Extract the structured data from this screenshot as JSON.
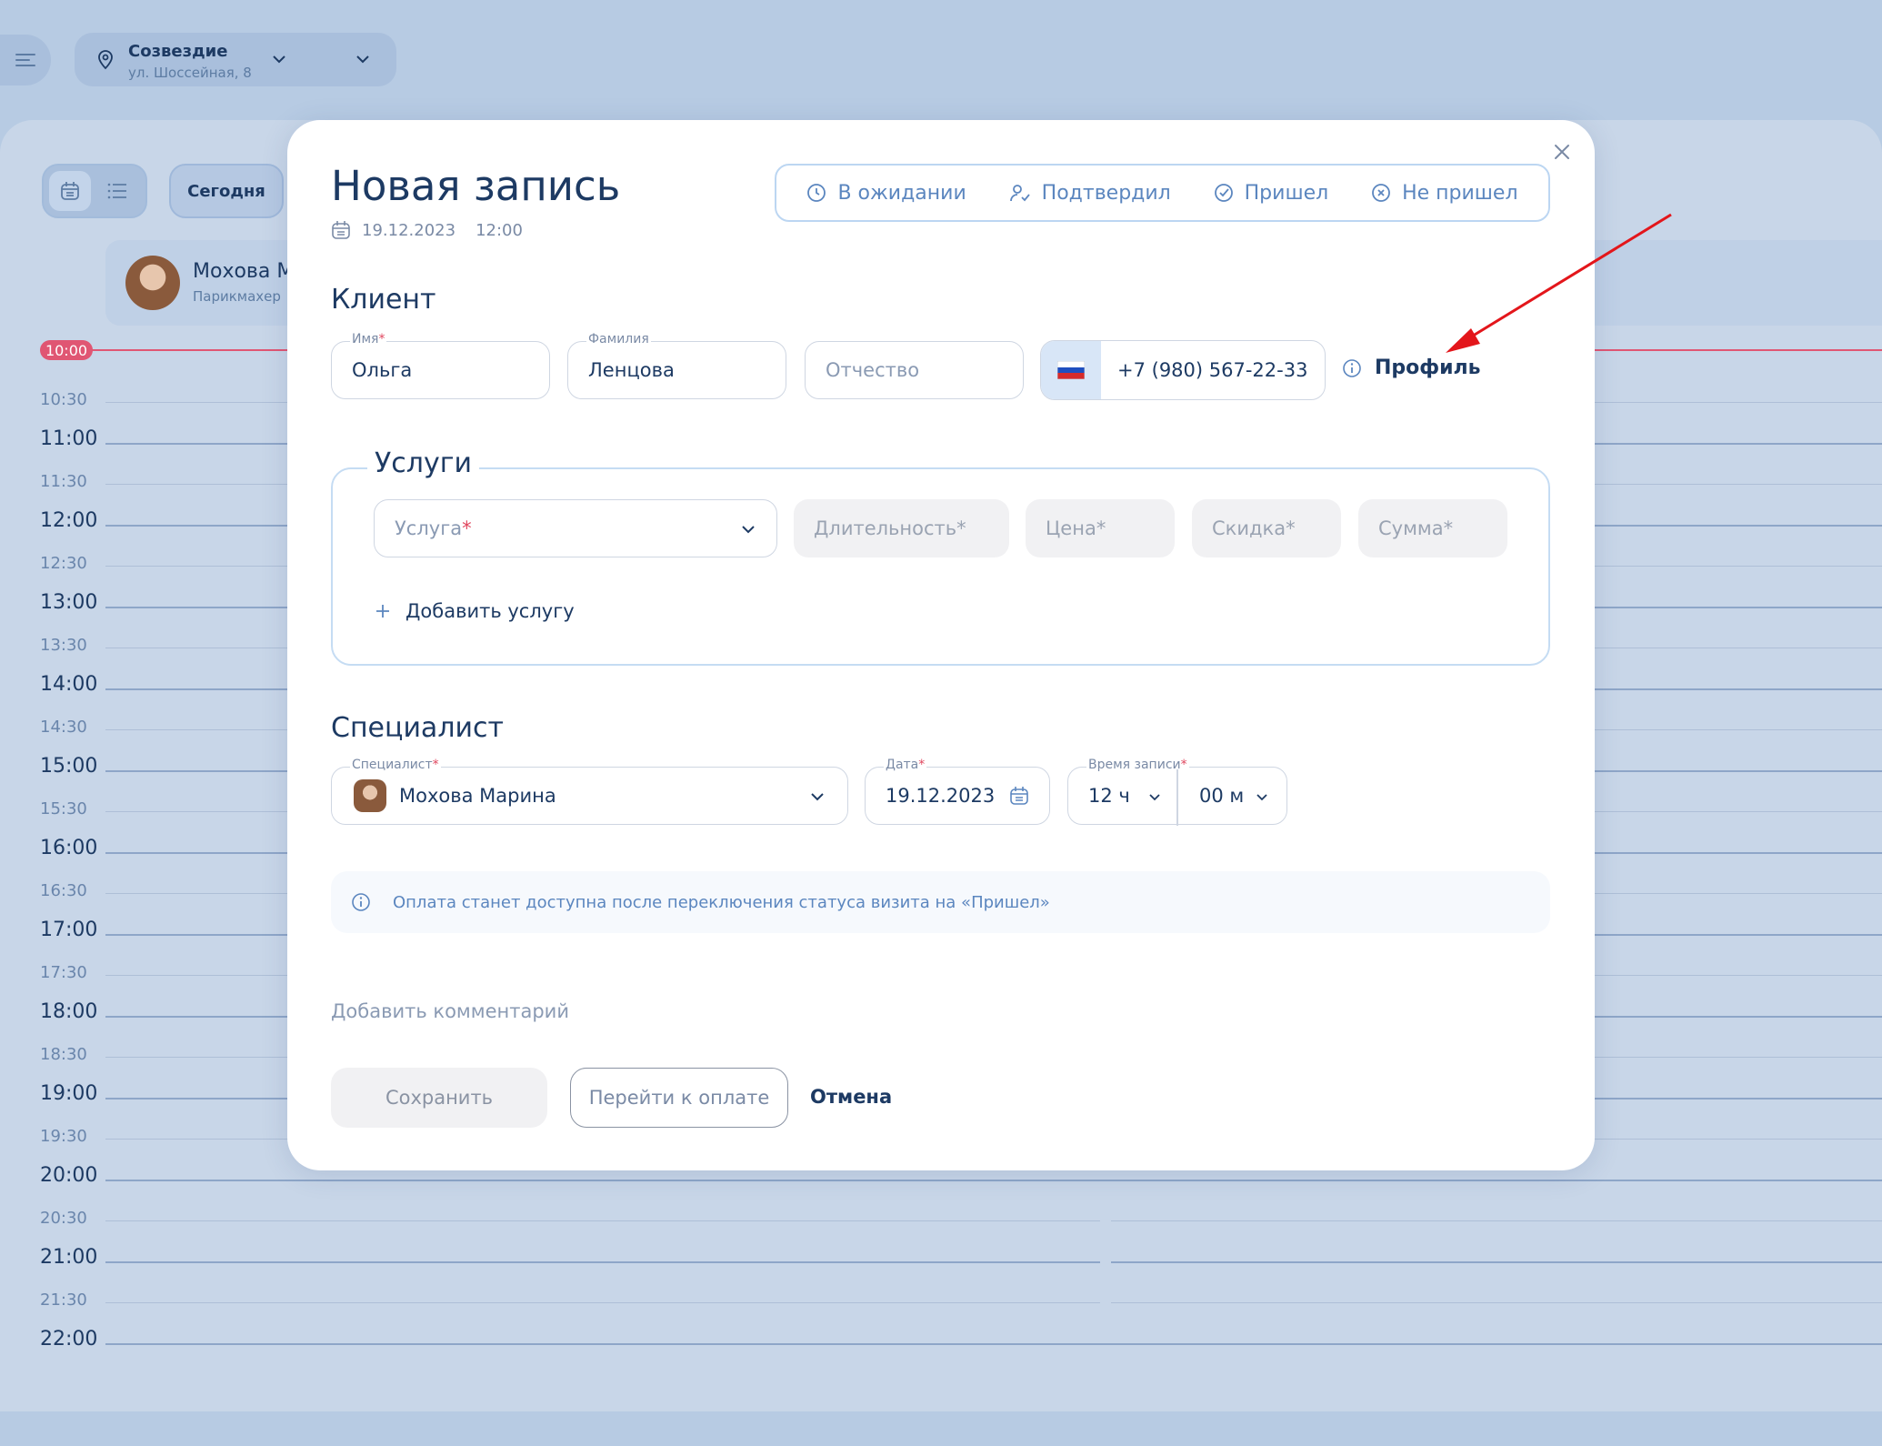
{
  "topbar": {
    "location_name": "Созвездие",
    "location_address": "ул. Шоссейная, 8"
  },
  "toolbar": {
    "today_label": "Сегодня"
  },
  "staff": {
    "name": "Мохова М",
    "role": "Парикмахер"
  },
  "timeline": {
    "now_badge": "10:00",
    "slots": [
      "10:30",
      "11:00",
      "11:30",
      "12:00",
      "12:30",
      "13:00",
      "13:30",
      "14:00",
      "14:30",
      "15:00",
      "15:30",
      "16:00",
      "16:30",
      "17:00",
      "17:30",
      "18:00",
      "18:30",
      "19:00",
      "19:30",
      "20:00",
      "20:30",
      "21:00",
      "21:30",
      "22:00"
    ]
  },
  "modal": {
    "title": "Новая запись",
    "date": "19.12.2023",
    "time": "12:00",
    "statuses": [
      {
        "label": "В ожидании",
        "icon": "clock-icon"
      },
      {
        "label": "Подтвердил",
        "icon": "user-check-icon"
      },
      {
        "label": "Пришел",
        "icon": "check-circle-icon"
      },
      {
        "label": "Не пришел",
        "icon": "x-circle-icon"
      }
    ],
    "client": {
      "heading": "Клиент",
      "first_name_label": "Имя",
      "first_name": "Ольга",
      "last_name_label": "Фамилия",
      "last_name": "Ленцова",
      "patronymic_placeholder": "Отчество",
      "phone": "+7 (980) 567-22-33",
      "profile_label": "Профиль"
    },
    "services": {
      "heading": "Услуги",
      "service_placeholder": "Услуга",
      "duration_placeholder": "Длительность*",
      "price_placeholder": "Цена*",
      "discount_placeholder": "Скидка*",
      "sum_placeholder": "Сумма*",
      "add_label": "Добавить услугу"
    },
    "specialist": {
      "heading": "Специалист",
      "specialist_label": "Специалист",
      "specialist_value": "Мохова Марина",
      "date_label": "Дата",
      "date_value": "19.12.2023",
      "time_label": "Время записи",
      "hours_value": "12 ч",
      "minutes_value": "00 м"
    },
    "info_text": "Оплата станет доступна после переключения статуса визита на «Пришел»",
    "comment_label": "Добавить комментарий",
    "buttons": {
      "save": "Сохранить",
      "pay": "Перейти к оплате",
      "cancel": "Отмена"
    }
  },
  "colors": {
    "accent": "#5b86bf",
    "annotation_arrow": "#e3161b",
    "now_line": "#e05673"
  }
}
